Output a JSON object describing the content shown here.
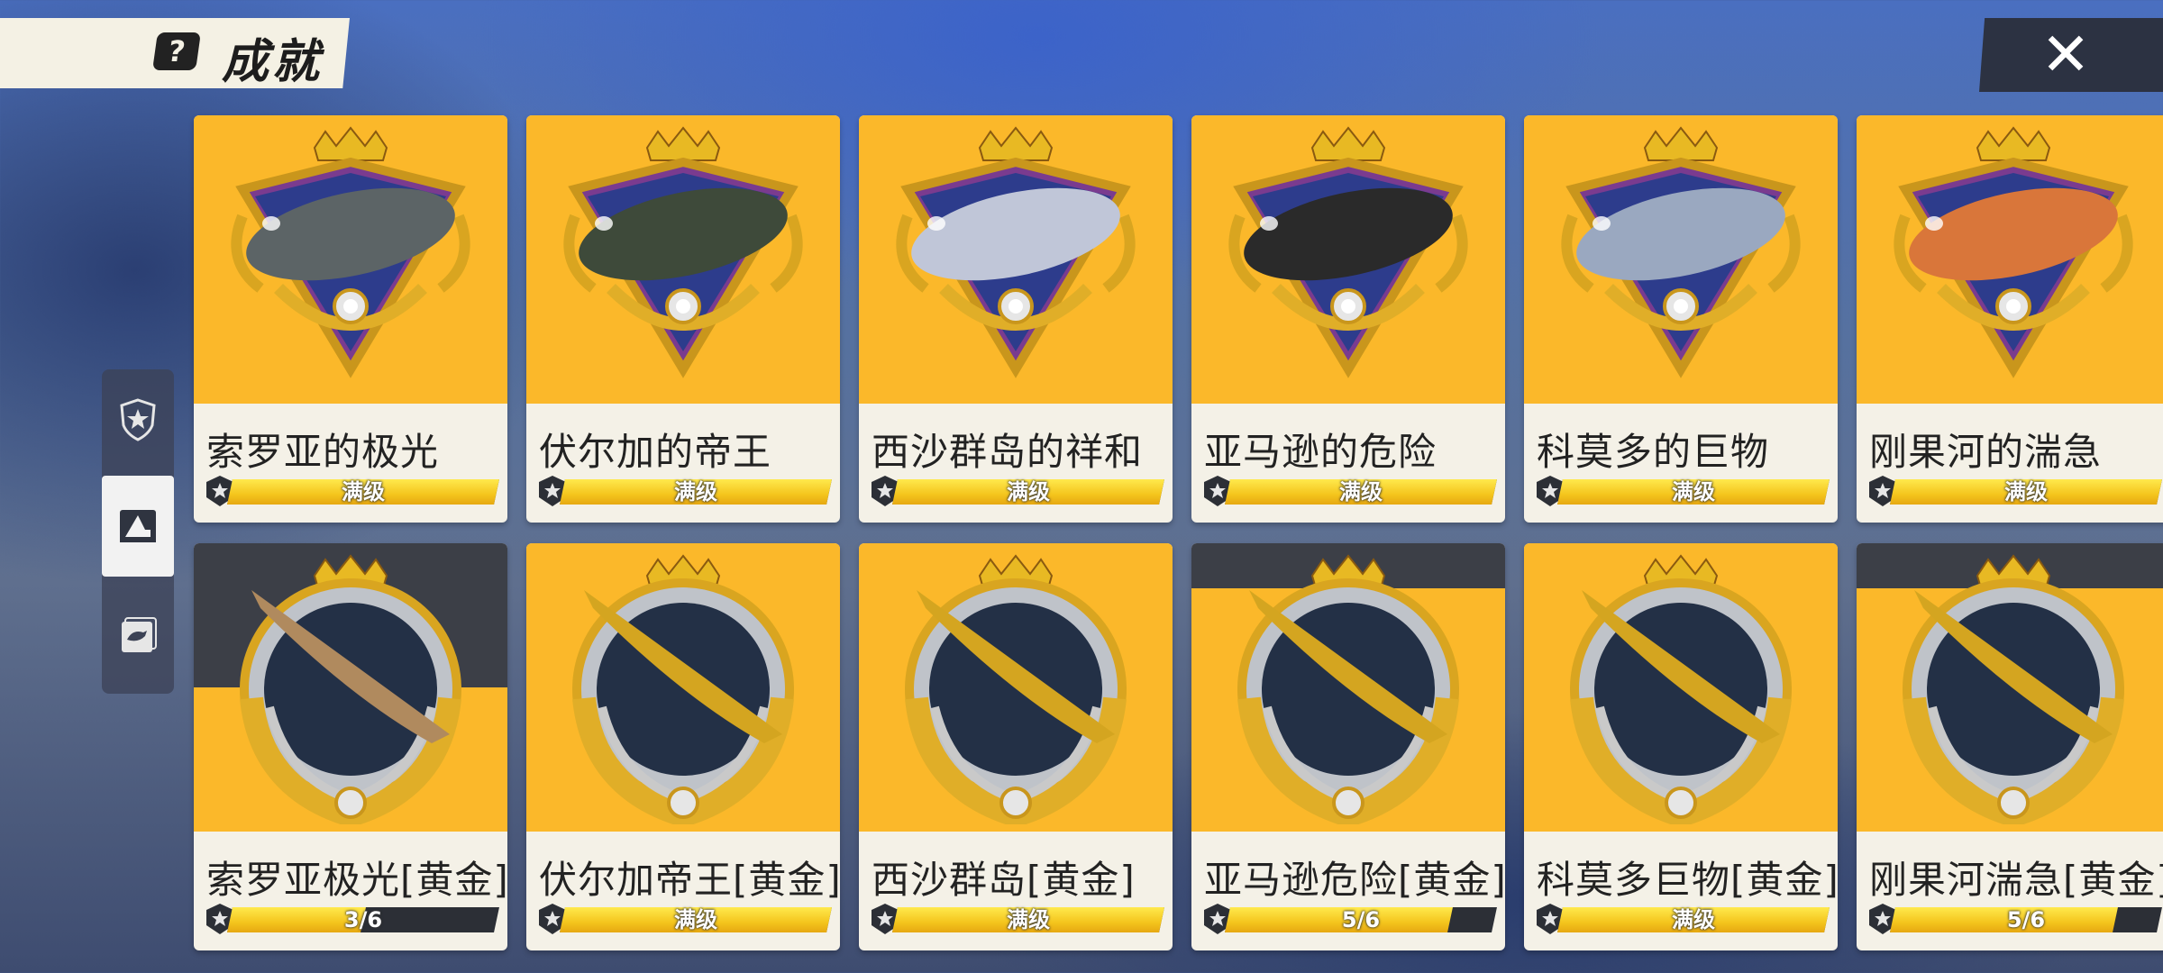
{
  "header": {
    "title": "成就",
    "help_icon": "help-icon",
    "close_icon": "close-icon"
  },
  "colors": {
    "card_bg": "#fbb82a",
    "bar_fill": "#f4c51d",
    "bar_empty": "#2c2f36",
    "close_bg": "#2c3242"
  },
  "side_tabs": [
    {
      "icon": "shield-star-icon",
      "active": false
    },
    {
      "icon": "shark-card-icon",
      "active": true
    },
    {
      "icon": "fish-journal-icon",
      "active": false
    }
  ],
  "cards": [
    {
      "name": "索罗亚的极光",
      "progress_text": "满级",
      "progress": 1.0,
      "fish_color": "#5c6466",
      "style": "crest"
    },
    {
      "name": "伏尔加的帝王",
      "progress_text": "满级",
      "progress": 1.0,
      "fish_color": "#3e4a3a",
      "style": "crest"
    },
    {
      "name": "西沙群岛的祥和",
      "progress_text": "满级",
      "progress": 1.0,
      "fish_color": "#c0c6d8",
      "style": "crest"
    },
    {
      "name": "亚马逊的危险",
      "progress_text": "满级",
      "progress": 1.0,
      "fish_color": "#2a2a2a",
      "style": "crest"
    },
    {
      "name": "科莫多的巨物",
      "progress_text": "满级",
      "progress": 1.0,
      "fish_color": "#9aa8c0",
      "style": "crest"
    },
    {
      "name": "刚果河的湍急",
      "progress_text": "满级",
      "progress": 1.0,
      "fish_color": "#d9763a",
      "style": "crest"
    },
    {
      "name": "索罗亚极光[黄金]",
      "progress_text": "3/6",
      "progress": 0.5,
      "fish_color": "#b08a5e",
      "style": "laurel"
    },
    {
      "name": "伏尔加帝王[黄金]",
      "progress_text": "满级",
      "progress": 1.0,
      "fish_color": "#d4a520",
      "style": "laurel"
    },
    {
      "name": "西沙群岛[黄金]",
      "progress_text": "满级",
      "progress": 1.0,
      "fish_color": "#d4a520",
      "style": "laurel"
    },
    {
      "name": "亚马逊危险[黄金]",
      "progress_text": "5/6",
      "progress": 0.833,
      "fish_color": "#d4a520",
      "style": "laurel"
    },
    {
      "name": "科莫多巨物[黄金]",
      "progress_text": "满级",
      "progress": 1.0,
      "fish_color": "#d4a520",
      "style": "laurel"
    },
    {
      "name": "刚果河湍急[黄金]",
      "progress_text": "5/6",
      "progress": 0.833,
      "fish_color": "#d4a520",
      "style": "laurel"
    }
  ]
}
